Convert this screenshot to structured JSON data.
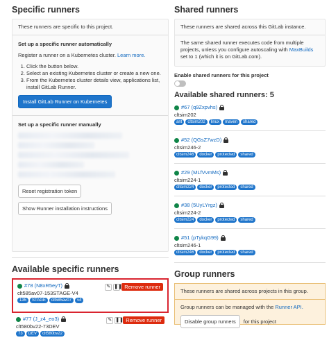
{
  "specific": {
    "title": "Specific runners",
    "intro": "These runners are specific to this project.",
    "auto_heading": "Set up a specific runner automatically",
    "auto_text": "Register a runner on a Kubernetes cluster.",
    "learn_more": "Learn more.",
    "steps": [
      "Click the button below.",
      "Select an existing Kubernetes cluster or create a new one.",
      "From the Kubernetes cluster details view, applications list, install GitLab Runner."
    ],
    "install_button": "Install GitLab Runner on Kubernetes",
    "manual_heading": "Set up a specific runner manually",
    "reset_button": "Reset registration token",
    "show_instructions_button": "Show Runner installation instructions"
  },
  "available_specific": {
    "title": "Available specific runners",
    "remove_label": "Remove runner",
    "runners": [
      {
        "id": "#78 (N8xR5eyT)",
        "desc": "clt585av07-153STAGE-V4",
        "tags": [
          "135",
          "STAGE",
          "clt585av07",
          "v4"
        ],
        "highlighted": true
      },
      {
        "id": "#77 (J_z4_eo3)",
        "desc": "clt580bv22-73DEV",
        "tags": [
          "73",
          "DEV",
          "clt580bv22"
        ],
        "highlighted": false
      }
    ]
  },
  "shared": {
    "title": "Shared runners",
    "intro": "These runners are shared across this GitLab instance.",
    "info_text": "The same shared runner executes code from multiple projects, unless you configure autoscaling with",
    "info_link": "MaxBuilds",
    "info_tail": "set to 1 (which it is on GitLab.com).",
    "enable_label": "Enable shared runners for this project",
    "available_title": "Available shared runners: 5",
    "runners": [
      {
        "id": "#67 (q9Zxpvhs)",
        "desc": "cltsim202",
        "tags": [
          "ant",
          "cltsim202",
          "linux",
          "maven",
          "shared"
        ]
      },
      {
        "id": "#52 (QGsZ7wzD)",
        "desc": "cltsim246-2",
        "tags": [
          "cltsim246",
          "docker",
          "protected",
          "shared"
        ]
      },
      {
        "id": "#29 (MLfVvmMs)",
        "desc": "cltsim224-1",
        "tags": [
          "cltsim224",
          "docker",
          "protected",
          "shared"
        ]
      },
      {
        "id": "#38 (5UyLYrgz)",
        "desc": "cltsim224-2",
        "tags": [
          "cltsim224",
          "docker",
          "protected",
          "shared"
        ]
      },
      {
        "id": "#51 (pTykqG99)",
        "desc": "cltsim246-1",
        "tags": [
          "cltsim246",
          "docker",
          "protected",
          "shared"
        ]
      }
    ]
  },
  "group": {
    "title": "Group runners",
    "intro": "These runners are shared across projects in this group.",
    "manage_text": "Group runners can be managed with the",
    "manage_link": "Runner API.",
    "disable_button": "Disable group runners",
    "disable_tail": "for this project"
  },
  "colors": {
    "tag_blue": "#1f75cb",
    "remove_red": "#dd2b0e",
    "online_green": "#108548",
    "highlight": "#d9242f"
  }
}
